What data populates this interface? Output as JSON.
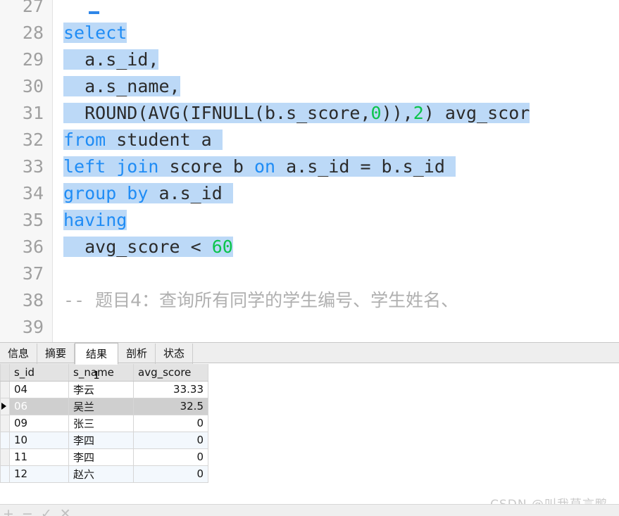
{
  "editor": {
    "first_visible_line": 27,
    "lines": [
      {
        "number": "27",
        "segments": []
      },
      {
        "number": "28",
        "segments": [
          {
            "text": "select",
            "type": "keyword",
            "selected": true
          }
        ]
      },
      {
        "number": "29",
        "segments": [
          {
            "text": "  a.s_id,",
            "type": "plain",
            "selected": true
          }
        ]
      },
      {
        "number": "30",
        "segments": [
          {
            "text": "  a.s_name,",
            "type": "plain",
            "selected": true
          }
        ]
      },
      {
        "number": "31",
        "segments": [
          {
            "text": "  ROUND(AVG(IFNULL(b.s_score,",
            "type": "plain",
            "selected": true
          },
          {
            "text": "0",
            "type": "number",
            "selected": true
          },
          {
            "text": ")),",
            "type": "plain",
            "selected": true
          },
          {
            "text": "2",
            "type": "number",
            "selected": true
          },
          {
            "text": ") avg_scor",
            "type": "plain",
            "selected": true
          }
        ]
      },
      {
        "number": "32",
        "segments": [
          {
            "text": "from",
            "type": "keyword",
            "selected": true
          },
          {
            "text": " student a ",
            "type": "plain",
            "selected": true
          }
        ]
      },
      {
        "number": "33",
        "segments": [
          {
            "text": "left join",
            "type": "keyword",
            "selected": true
          },
          {
            "text": " score b ",
            "type": "plain",
            "selected": true
          },
          {
            "text": "on",
            "type": "keyword",
            "selected": true
          },
          {
            "text": " a.s_id = b.s_id ",
            "type": "plain",
            "selected": true
          }
        ]
      },
      {
        "number": "34",
        "segments": [
          {
            "text": "group by",
            "type": "keyword",
            "selected": true
          },
          {
            "text": " a.s_id ",
            "type": "plain",
            "selected": true
          }
        ]
      },
      {
        "number": "35",
        "segments": [
          {
            "text": "having",
            "type": "keyword",
            "selected": true
          }
        ]
      },
      {
        "number": "36",
        "segments": [
          {
            "text": "  avg_score < ",
            "type": "plain",
            "selected": true
          },
          {
            "text": "60",
            "type": "number",
            "selected": true
          }
        ]
      },
      {
        "number": "37",
        "segments": []
      },
      {
        "number": "38",
        "segments": [
          {
            "text": "-- ",
            "type": "comment",
            "selected": false
          },
          {
            "text": "题目4：查询所有同学的学生编号、学生姓名、",
            "type": "comment-cjk",
            "selected": false
          }
        ]
      },
      {
        "number": "39",
        "segments": []
      }
    ]
  },
  "result_panel": {
    "tabs": [
      {
        "label": "信息",
        "active": false
      },
      {
        "label": "摘要",
        "active": false
      },
      {
        "label": "结果 1",
        "active": true
      },
      {
        "label": "剖析",
        "active": false
      },
      {
        "label": "状态",
        "active": false
      }
    ],
    "grid": {
      "columns": [
        "s_id",
        "s_name",
        "avg_score"
      ],
      "rows": [
        {
          "s_id": "04",
          "s_name": "李云",
          "avg_score": "33.33",
          "selected": false
        },
        {
          "s_id": "06",
          "s_name": "吴兰",
          "avg_score": "32.5",
          "selected": true
        },
        {
          "s_id": "09",
          "s_name": "张三",
          "avg_score": "0",
          "selected": false
        },
        {
          "s_id": "10",
          "s_name": "李四",
          "avg_score": "0",
          "selected": false
        },
        {
          "s_id": "11",
          "s_name": "李四",
          "avg_score": "0",
          "selected": false
        },
        {
          "s_id": "12",
          "s_name": "赵六",
          "avg_score": "0",
          "selected": false
        }
      ]
    }
  },
  "statusbar": {
    "nav_icons": [
      "+",
      "−",
      "✓",
      "✕"
    ]
  },
  "watermark": {
    "text": "CSDN @叫我莫言鸭"
  },
  "colors": {
    "keyword": "#1f8cf5",
    "number_literal": "#0ac44a",
    "comment": "#b0b0b0",
    "selection": "#bcd9f7",
    "row_selected": "#cfcfcf",
    "row_alt": "#f3f8fd",
    "header": "#e3e3e3"
  }
}
